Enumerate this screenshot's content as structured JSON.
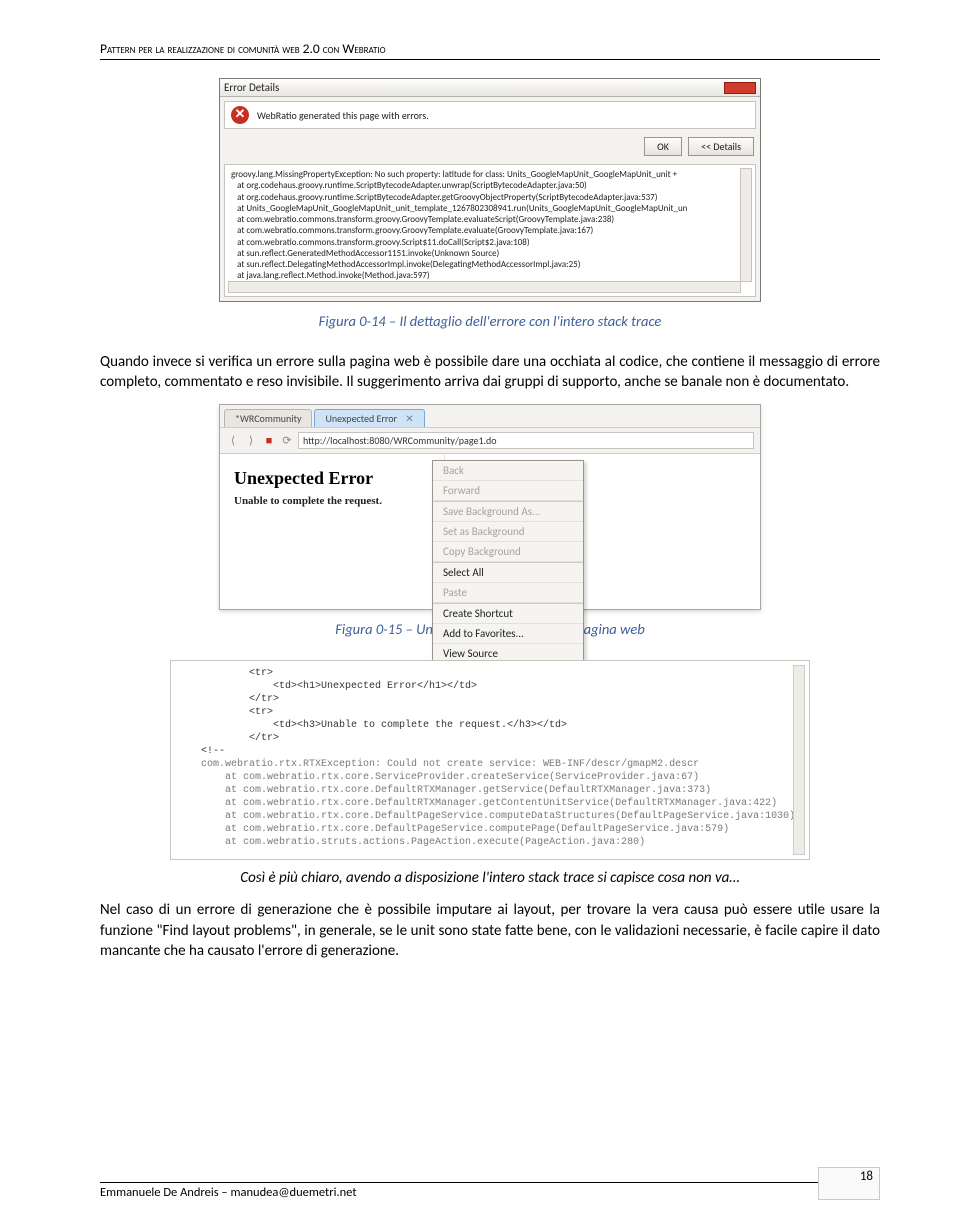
{
  "header": "Pattern per la realizzazione di comunità web 2.0 con Webratio",
  "fig1": {
    "title": "Error Details",
    "msg": "WebRatio generated this page with errors.",
    "btn_ok": "OK",
    "btn_details": "<< Details",
    "trace": "groovy.lang.MissingPropertyException: No such property: latitude for class: Units_GoogleMapUnit_GoogleMapUnit_unit +\n   at org.codehaus.groovy.runtime.ScriptBytecodeAdapter.unwrap(ScriptBytecodeAdapter.java:50)\n   at org.codehaus.groovy.runtime.ScriptBytecodeAdapter.getGroovyObjectProperty(ScriptBytecodeAdapter.java:537)\n   at Units_GoogleMapUnit_GoogleMapUnit_unit_template_1267802308941.run(Units_GoogleMapUnit_GoogleMapUnit_un\n   at com.webratio.commons.transform.groovy.GroovyTemplate.evaluateScript(GroovyTemplate.java:238)\n   at com.webratio.commons.transform.groovy.GroovyTemplate.evaluate(GroovyTemplate.java:167)\n   at com.webratio.commons.transform.groovy.Script$11.doCall(Script$2.java:108)\n   at sun.reflect.GeneratedMethodAccessor1151.invoke(Unknown Source)\n   at sun.reflect.DelegatingMethodAccessorImpl.invoke(DelegatingMethodAccessorImpl.java:25)\n   at java.lang.reflect.Method.invoke(Method.java:597)"
  },
  "caption1": "Figura 0-14 – Il dettaglio dell'errore con l'intero stack trace",
  "para1": "Quando invece si verifica un errore sulla pagina web è possibile dare una occhiata al codice, che contiene il messaggio di errore completo, commentato e reso invisibile. Il suggerimento arriva dai gruppi di supporto, anche se banale non è documentato.",
  "fig2": {
    "tab1": "*WRCommunity",
    "tab2": "Unexpected Error",
    "url": "http://localhost:8080/WRCommunity/page1.do",
    "h1": "Unexpected Error",
    "h3": "Unable to complete the request.",
    "menu": {
      "back": "Back",
      "forward": "Forward",
      "savebg": "Save Background As...",
      "setbg": "Set as Background",
      "copybg": "Copy Background",
      "selall": "Select All",
      "paste": "Paste",
      "shortcut": "Create Shortcut",
      "addfav": "Add to Favorites...",
      "viewsrc": "View Source"
    }
  },
  "caption2": "Figura 0-15 – Un errore inaspettato sulla pagina web",
  "fig3": {
    "html_lines": "        <tr>\n            <td><h1>Unexpected Error</h1></td>\n        </tr>\n        <tr>\n            <td><h3>Unable to complete the request.</h3></td>\n        </tr>\n<!--",
    "comment_block": "com.webratio.rtx.RTXException: Could not create service: WEB-INF/descr/gmapM2.descr\n    at com.webratio.rtx.core.ServiceProvider.createService(ServiceProvider.java:67)\n    at com.webratio.rtx.core.DefaultRTXManager.getService(DefaultRTXManager.java:373)\n    at com.webratio.rtx.core.DefaultRTXManager.getContentUnitService(DefaultRTXManager.java:422)\n    at com.webratio.rtx.core.DefaultPageService.computeDataStructures(DefaultPageService.java:1030)\n    at com.webratio.rtx.core.DefaultPageService.computePage(DefaultPageService.java:579)\n    at com.webratio.struts.actions.PageAction.execute(PageAction.java:280)"
  },
  "para2": "Così è più chiaro, avendo a disposizione l'intero stack trace si capisce cosa non va…",
  "para3": "Nel caso di un errore di generazione che è possibile imputare ai layout, per trovare la vera causa può essere utile usare la funzione \"Find layout problems\", in generale, se le unit sono state fatte bene, con le validazioni necessarie, è facile capire il dato mancante che ha causato l'errore di generazione.",
  "footer": {
    "left": "Emmanuele De Andreis – manudea@duemetri.net",
    "page": "18"
  }
}
